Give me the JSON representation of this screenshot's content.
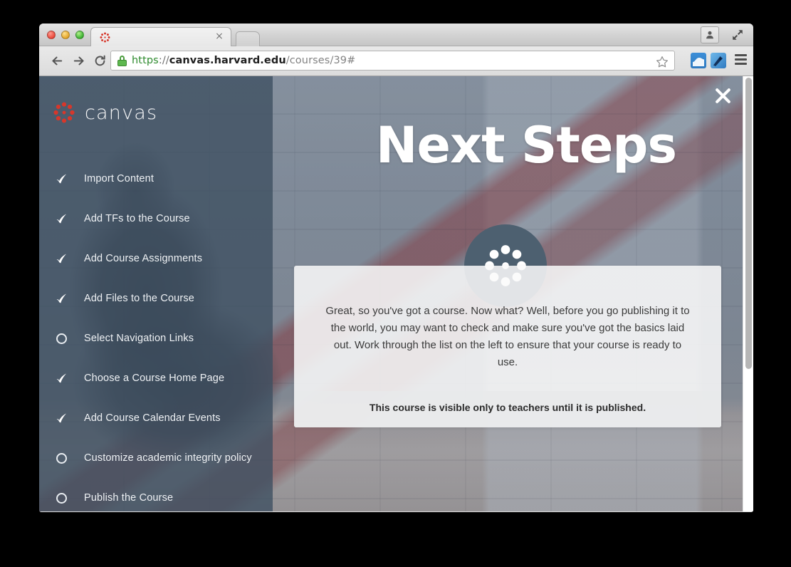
{
  "window": {
    "traffic_lights": [
      "close",
      "minimize",
      "maximize"
    ],
    "profile_icon": "person-icon",
    "fullscreen_icon": "fullscreen-arrows-icon"
  },
  "tab": {
    "favicon": "canvas-logo-favicon",
    "title": "",
    "close_label": "×",
    "new_tab_label": ""
  },
  "toolbar": {
    "back_label": "←",
    "forward_label": "→",
    "reload_label": "⟳",
    "security_icon": "lock-icon",
    "url": {
      "scheme": "https",
      "separator": "://",
      "host": "canvas.harvard.edu",
      "path": "/courses/39#",
      "full": "https://canvas.harvard.edu/courses/39#"
    },
    "bookmark_icon": "star-icon",
    "extensions": [
      "extension-icon-blue-window",
      "extension-icon-blue-pen"
    ],
    "menu_icon": "hamburger-menu-icon"
  },
  "sidebar": {
    "brand": "canvas",
    "brand_color": "#D7372B",
    "background_color": "#3E5062",
    "items": [
      {
        "label": "Import Content",
        "state": "checked"
      },
      {
        "label": "Add TFs to the Course",
        "state": "checked"
      },
      {
        "label": "Add Course Assignments",
        "state": "checked"
      },
      {
        "label": "Add Files to the Course",
        "state": "checked"
      },
      {
        "label": "Select Navigation Links",
        "state": "unchecked"
      },
      {
        "label": "Choose a Course Home Page",
        "state": "checked"
      },
      {
        "label": "Add Course Calendar Events",
        "state": "checked"
      },
      {
        "label": "Customize academic integrity policy",
        "state": "unchecked"
      },
      {
        "label": "Publish the Course",
        "state": "unchecked"
      }
    ]
  },
  "hero": {
    "title": "Next Steps",
    "badge_icon": "canvas-logo-icon",
    "badge_color": "#4D6070",
    "close_icon": "close-x-icon"
  },
  "panel": {
    "body": "Great, so you've got a course. Now what? Well, before you go publishing it to the world, you may want to check and make sure you've got the basics laid out. Work through the list on the left to ensure that your course is ready to use.",
    "notice": "This course is visible only to teachers until it is published."
  },
  "scrollbar": {
    "orientation": "vertical",
    "thumb_position": "top"
  }
}
